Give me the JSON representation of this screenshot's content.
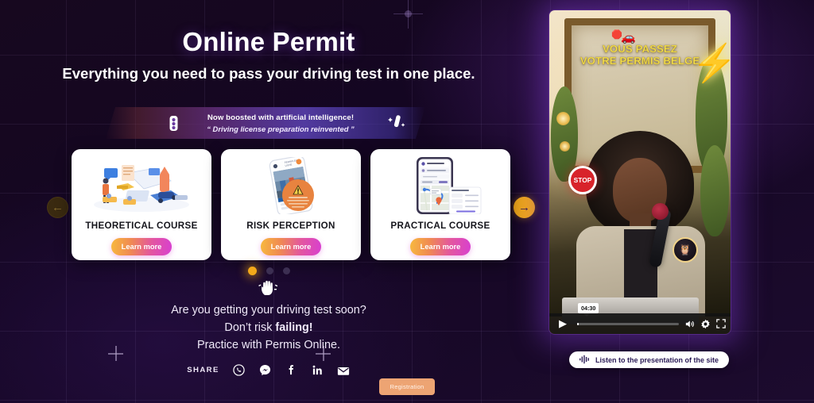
{
  "hero": {
    "title": "Online Permit",
    "subtitle": "Everything you need to pass your driving test in one place."
  },
  "ai_banner": {
    "line1": "Now boosted with artificial intelligence!",
    "line2": "“ Driving license preparation reinvented ”",
    "left_icon": "traffic-light-icon",
    "right_icon": "magic-wand-icon"
  },
  "carousel": {
    "prev_label": "←",
    "next_label": "→",
    "dots": [
      true,
      false,
      false
    ],
    "cards": [
      {
        "title": "THEORETICAL COURSE",
        "button": "Learn more",
        "art": "isometric-online-learning-illustration"
      },
      {
        "title": "RISK PERCEPTION",
        "button": "Learn more",
        "art": "phone-hazard-warning-illustration"
      },
      {
        "title": "PRACTICAL COURSE",
        "button": "Learn more",
        "art": "phone-map-lessons-illustration"
      }
    ]
  },
  "pitch": {
    "hand_icon": "raised-hand-icon",
    "line1": "Are you getting your driving test soon?",
    "line2_prefix": "Don’t risk ",
    "line2_bold": "failing!",
    "line3": "Practice with Permis Online."
  },
  "share": {
    "label": "SHARE",
    "items": [
      {
        "name": "whatsapp-icon",
        "glyph": "✆"
      },
      {
        "name": "messenger-icon",
        "glyph": "⚡"
      },
      {
        "name": "facebook-icon",
        "glyph": "f"
      },
      {
        "name": "linkedin-icon",
        "glyph": "in"
      },
      {
        "name": "email-icon",
        "glyph": "✉"
      }
    ]
  },
  "register": {
    "label": "Registration"
  },
  "video": {
    "overlay_line1": "VOUS PASSEZ",
    "overlay_line2": "VOTRE PERMIS BELGE",
    "car_emoji": "🚗",
    "stop_label": "STOP",
    "badge_icon": "owl-logo-icon",
    "time": "04:30",
    "play_icon": "▶",
    "volume_icon": "🔊",
    "settings_icon": "⚙",
    "fullscreen_icon": "⛶"
  },
  "listen": {
    "label": "Listen to the presentation of the site",
    "icon": "audio-waveform-icon"
  },
  "colors": {
    "background": "#140622",
    "accent_gold": "#f3a91a",
    "card_bg": "#ffffff",
    "register_bg": "#eda473",
    "overlay_yellow": "#f7e14e"
  }
}
